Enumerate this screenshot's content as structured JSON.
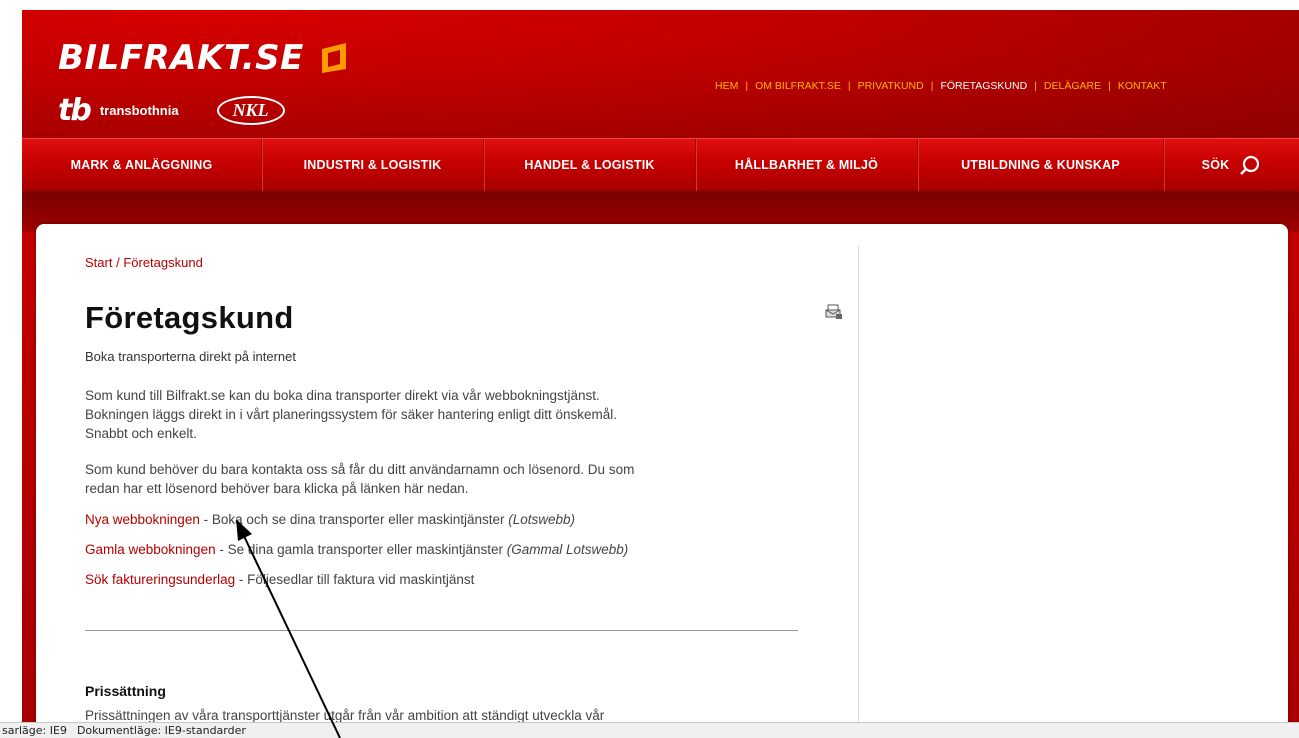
{
  "brand": {
    "logo": "BILFRAKT.SE",
    "partner1_mark": "tb",
    "partner1_name": "transbothnia",
    "partner2": "NKL"
  },
  "topnav": [
    {
      "label": "HEM",
      "active": false
    },
    {
      "label": "OM BILFRAKT.SE",
      "active": false
    },
    {
      "label": "PRIVATKUND",
      "active": false
    },
    {
      "label": "FÖRETAGSKUND",
      "active": true
    },
    {
      "label": "DELÄGARE",
      "active": false
    },
    {
      "label": "KONTAKT",
      "active": false
    }
  ],
  "mainnav": [
    {
      "label": "MARK & ANLÄGGNING"
    },
    {
      "label": "INDUSTRI & LOGISTIK"
    },
    {
      "label": "HANDEL & LOGISTIK"
    },
    {
      "label": "HÅLLBARHET & MILJÖ"
    },
    {
      "label": "UTBILDNING & KUNSKAP"
    },
    {
      "label": "SÖK"
    }
  ],
  "breadcrumb": {
    "start": "Start",
    "separator": " / ",
    "current": "Företagskund"
  },
  "page": {
    "title": "Företagskund",
    "subtitle": "Boka transporterna direkt på internet",
    "p1_line1": "Som kund till Bilfrakt.se kan du boka dina transporter direkt via vår webbokningstjänst.",
    "p1_line2": "Bokningen läggs direkt in i vårt planeringssystem för säker hantering enligt ditt önskemål.",
    "p1_line3": "Snabbt och enkelt.",
    "p2_line1": "Som kund behöver du bara kontakta oss så får du ditt användarnamn och lösenord. Du som",
    "p2_line2": "redan har ett lösenord behöver bara klicka på länken här nedan.",
    "links": [
      {
        "link": "Nya webbokningen",
        "text": " - Boka och se dina transporter eller maskintjänster ",
        "note": "(Lotswebb)"
      },
      {
        "link": "Gamla webbokningen",
        "text": " - Se dina gamla transporter eller maskintjänster ",
        "note": "(Gammal Lotswebb)"
      },
      {
        "link": "Sök faktureringsunderlag",
        "text": " - Följesedlar till faktura vid maskintjänst",
        "note": ""
      }
    ],
    "section_title": "Prissättning",
    "section_text": "Prissättningen av våra transporttjänster utgår från vår ambition att ständigt utveckla vår"
  },
  "statusbar": {
    "left": "sarläge: IE9",
    "right": "Dokumentläge: IE9-standarder"
  },
  "colors": {
    "brand_red": "#c20000",
    "link_red": "#b50000",
    "topnav_orange": "#ffb400"
  }
}
